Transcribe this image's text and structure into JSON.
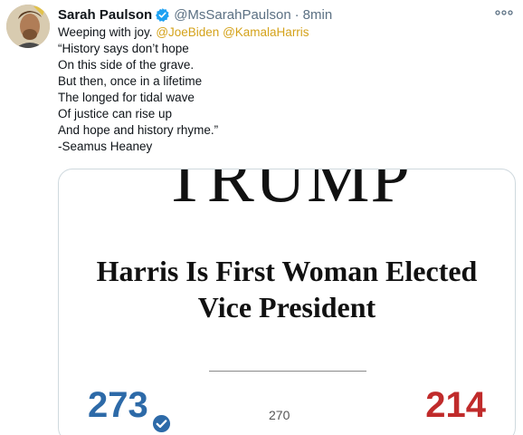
{
  "tweet": {
    "author": {
      "name": "Sarah Paulson",
      "handle": "@MsSarahPaulson",
      "separator": "·",
      "time": "8min"
    },
    "text": {
      "line1_prefix": "Weeping with joy. ",
      "mention1": "@JoeBiden",
      "mention2": "@KamalaHarris",
      "lines": [
        "“History says don’t hope",
        "On this side of the grave.",
        "But then, once in a lifetime",
        "The longed for tidal wave",
        "Of justice can rise up",
        "And hope and history rhyme.”",
        "-Seamus Heaney"
      ]
    },
    "image": {
      "banner": "TRUMP",
      "headline_line1": "Harris Is First Woman Elected",
      "headline_line2": "Vice President",
      "dem_votes": "273",
      "votes_needed": "270",
      "rep_votes": "214"
    }
  },
  "colors": {
    "mention": "#d4a21a",
    "verified": "#1da1f2",
    "dem": "#2d6aa8",
    "rep": "#c02b2b"
  },
  "icons": {
    "verified": "verified-badge-icon",
    "more": "more-options-icon",
    "dem_check": "check-circle-icon"
  }
}
